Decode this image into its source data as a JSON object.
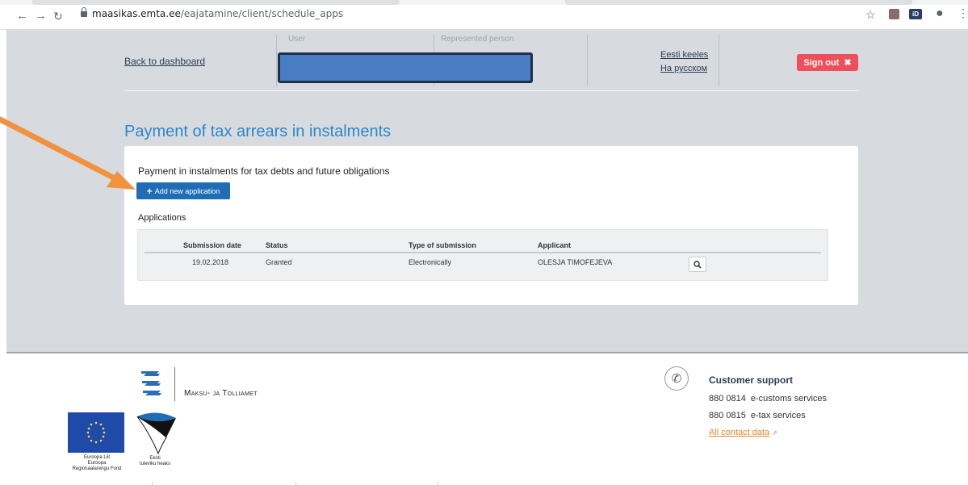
{
  "browser": {
    "url_host": "maasikas.emta.ee",
    "url_path": "/eajatamine/client/schedule_apps",
    "icons": [
      "back-icon",
      "forward-icon",
      "reload-icon",
      "lock-icon",
      "star-icon",
      "pdf-extension-icon",
      "id-extension-icon",
      "profile-icon",
      "menu-icon"
    ]
  },
  "header": {
    "back_link": "Back to dashboard",
    "user_label": "User",
    "represented_label": "Represented person",
    "lang_estonian": "Eesti keeles",
    "lang_russian": "На русском",
    "sign_out": "Sign out",
    "sign_out_icon": "✖"
  },
  "main": {
    "title": "Payment of tax arrears in instalments",
    "heading": "Payment in instalments for tax debts and future obligations",
    "add_button": "Add new application",
    "applications_label": "Applications",
    "table": {
      "columns": [
        "Submission date",
        "Status",
        "Type of submission",
        "Applicant"
      ],
      "rows": [
        {
          "date": "19.02.2018",
          "status": "Granted",
          "type": "Electronically",
          "applicant": "OLESJA TIMOFEJEVA"
        }
      ]
    }
  },
  "footer": {
    "org_name": "Maksu- ja Tolliamet",
    "eu_caption": [
      "Euroopa Liit",
      "Euroopa",
      "Regionaalarengu Fond"
    ],
    "ee_caption": [
      "Eesti",
      "tuleviku heaks"
    ],
    "support_title": "Customer support",
    "lines": [
      {
        "number": "880 0814",
        "label": "e-customs services"
      },
      {
        "number": "880 0815",
        "label": "e-tax services"
      }
    ],
    "contact_link": "All contact data"
  },
  "colors": {
    "accent": "#2d87c7",
    "sign_out": "#ef4f5a",
    "button": "#1f6eb5",
    "annotation_arrow": "#f0923e",
    "background": "#d7dbe0"
  }
}
